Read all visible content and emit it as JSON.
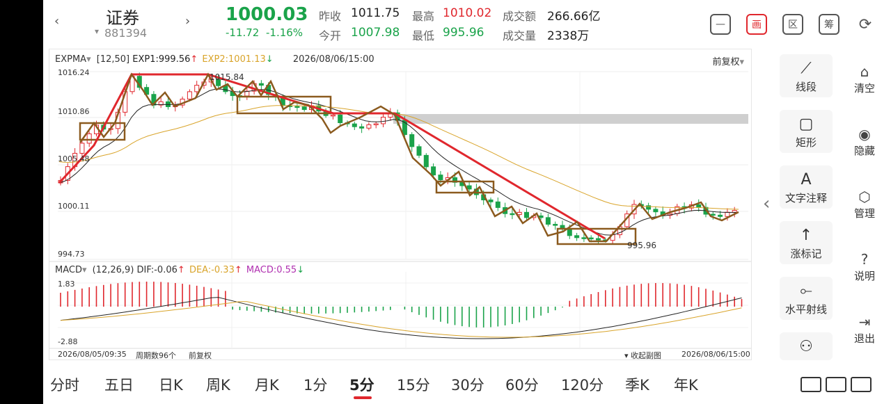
{
  "header": {
    "nav_left": "‹",
    "name": "证券",
    "code_prefix": "▾",
    "code": "881394",
    "nav_right": "›",
    "price": "1000.03",
    "change": "-11.72",
    "change_pct": "-1.16%",
    "prev_close_label": "昨收",
    "prev_close": "1011.75",
    "high_label": "最高",
    "high": "1010.02",
    "amount_label": "成交额",
    "amount": "266.66亿",
    "open_label": "今开",
    "open": "1007.98",
    "low_label": "最低",
    "low": "995.96",
    "volume_label": "成交量",
    "volume": "2338万",
    "icons": [
      {
        "name": "minimize-icon",
        "glyph": "—"
      },
      {
        "name": "draw-icon",
        "glyph": "画"
      },
      {
        "name": "interval-icon",
        "glyph": "区"
      },
      {
        "name": "chips-icon",
        "glyph": "筹"
      },
      {
        "name": "rotate-icon",
        "glyph": "⟳"
      }
    ]
  },
  "main_indicator": {
    "name": "EXPMA",
    "params": "[12,50]",
    "exp1": "EXP1:999.56",
    "exp1_arrow": "↑",
    "exp2": "EXP2:1001.13",
    "exp2_arrow": "↓",
    "time": "2026/08/06/15:00",
    "adjust": "前复权",
    "y_labels": [
      "1016.24",
      "1010.86",
      "1005.48",
      "1000.11",
      "994.73"
    ],
    "max_note": "1015.84",
    "min_note": "995.96",
    "arrow_icon": "▾"
  },
  "sub_indicator": {
    "name": "MACD",
    "params": "(12,26,9)",
    "dif": "DIF:-0.06",
    "dif_arrow": "↑",
    "dea": "DEA:-0.33",
    "dea_arrow": "↑",
    "macd": "MACD:0.55",
    "macd_arrow": "↓",
    "y_top": "1.83",
    "y_bottom": "-2.88"
  },
  "footer": {
    "start_time": "2026/08/05/09:35",
    "period_count": "周期数96个",
    "adjust": "前复权",
    "collapse": "收起副图",
    "end_time": "2026/08/06/15:00"
  },
  "tools": [
    {
      "label": "线段",
      "glyph": "⟋",
      "icon": "segment-icon"
    },
    {
      "label": "矩形",
      "glyph": "▢",
      "icon": "rectangle-icon"
    },
    {
      "label": "文字注释",
      "glyph": "A",
      "icon": "text-icon"
    },
    {
      "label": "涨标记",
      "glyph": "↑",
      "icon": "up-mark-icon"
    },
    {
      "label": "水平射线",
      "glyph": "⟜",
      "icon": "ray-icon"
    },
    {
      "label": "",
      "glyph": "⚇",
      "icon": "more-tool-icon"
    }
  ],
  "collapse_arrow": "‹",
  "side_actions": [
    {
      "label": "清空",
      "glyph": "⌂",
      "icon": "clear-icon"
    },
    {
      "label": "隐藏",
      "glyph": "◉",
      "icon": "eye-icon"
    },
    {
      "label": "管理",
      "glyph": "⬡",
      "icon": "manage-icon"
    },
    {
      "label": "说明",
      "glyph": "?",
      "icon": "help-icon"
    },
    {
      "label": "退出",
      "glyph": "⇥",
      "icon": "exit-icon"
    }
  ],
  "periods": [
    "分时",
    "五日",
    "日K",
    "周K",
    "月K",
    "1分",
    "5分",
    "15分",
    "30分",
    "60分",
    "120分",
    "季K",
    "年K"
  ],
  "active_period": "5分",
  "bottom_right_icon": "layout-icon",
  "colors": {
    "up": "#e0272d",
    "down": "#1aa34a",
    "exp1": "#222222",
    "exp2": "#d9a42a",
    "drawing_box": "#8b5a1e",
    "trend": "#e0272d"
  }
}
